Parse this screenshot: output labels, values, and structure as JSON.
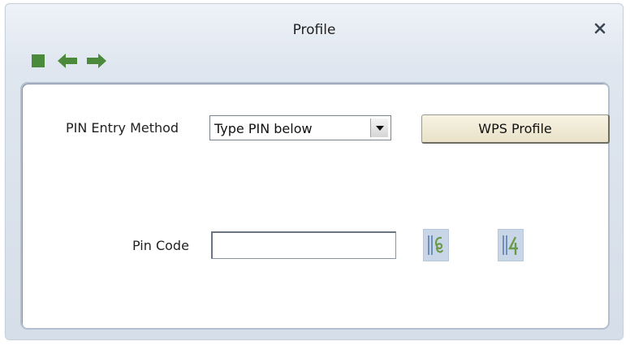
{
  "window": {
    "title": "Profile"
  },
  "toolbar": {
    "icons": [
      "stop-icon",
      "back-arrow-icon",
      "forward-arrow-icon"
    ]
  },
  "form": {
    "pin_method_label": "PIN Entry Method",
    "pin_method_value": "Type PIN below",
    "wps_profile_label": "WPS Profile",
    "pin_code_label": "Pin Code",
    "pin_code_value": ""
  },
  "actions": {
    "icons": [
      "generate-pin-icon",
      "copy-pin-icon"
    ]
  },
  "colors": {
    "toolbar_green": "#4b8a3a",
    "wps_button": "#eee8d2",
    "icon_button": "#c9d6e8"
  }
}
